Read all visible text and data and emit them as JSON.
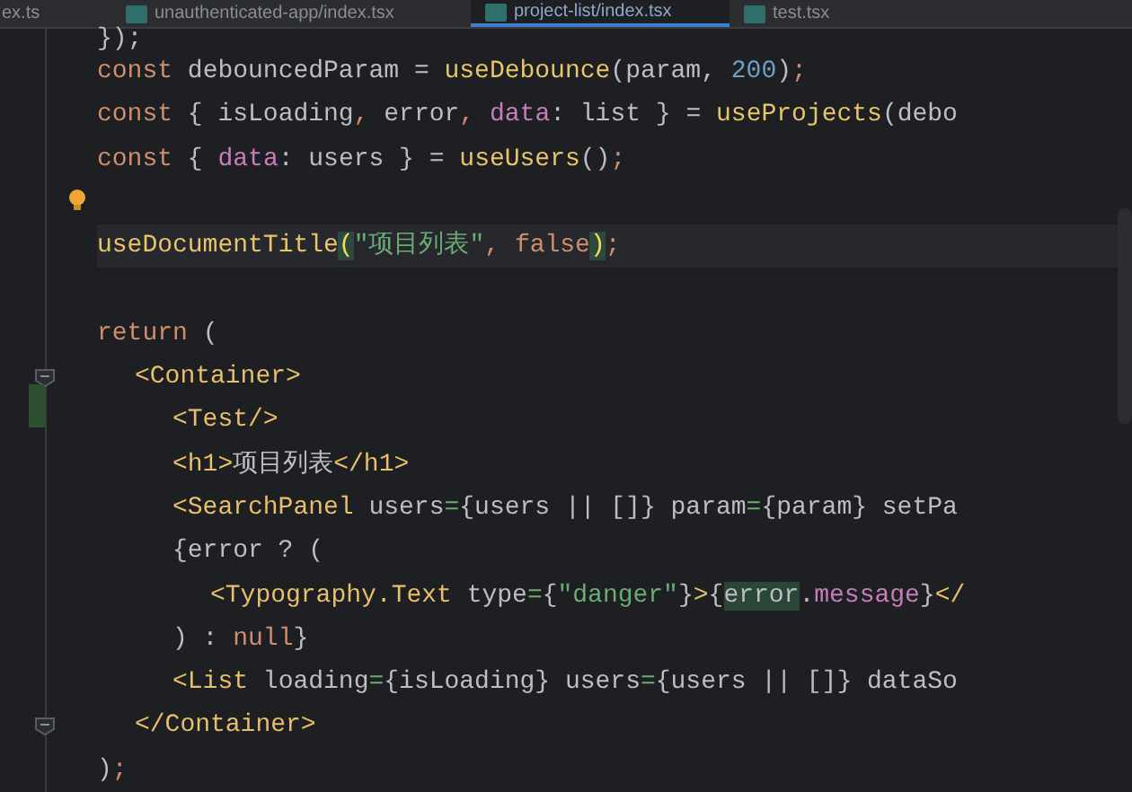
{
  "tabs": [
    {
      "label": "ex.ts",
      "selected": false,
      "icon": false
    },
    {
      "label": "unauthenticated-app/index.tsx",
      "selected": false,
      "icon": true
    },
    {
      "label": "project-list/index.tsx",
      "selected": true,
      "icon": true
    },
    {
      "label": "test.tsx",
      "selected": false,
      "icon": true
    }
  ],
  "lines": [
    {
      "current": false,
      "tokens": [
        {
          "kind": "plain",
          "text": "});"
        }
      ]
    },
    {
      "current": false,
      "tokens": [
        {
          "kind": "kw",
          "text": "const "
        },
        {
          "kind": "plain",
          "text": "debouncedParam = "
        },
        {
          "kind": "fn",
          "text": "useDebounce"
        },
        {
          "kind": "plain",
          "text": "(param, "
        },
        {
          "kind": "num",
          "text": "200"
        },
        {
          "kind": "plain",
          "text": ")"
        },
        {
          "kind": "kw",
          "text": ";"
        }
      ]
    },
    {
      "current": false,
      "tokens": [
        {
          "kind": "kw",
          "text": "const "
        },
        {
          "kind": "plain",
          "text": "{ isLoading"
        },
        {
          "kind": "kw",
          "text": ", "
        },
        {
          "kind": "plain",
          "text": "error"
        },
        {
          "kind": "kw",
          "text": ", "
        },
        {
          "kind": "prop",
          "text": "data"
        },
        {
          "kind": "plain",
          "text": ": list } = "
        },
        {
          "kind": "fn",
          "text": "useProjects"
        },
        {
          "kind": "plain",
          "text": "(debo"
        }
      ]
    },
    {
      "current": false,
      "tokens": [
        {
          "kind": "kw",
          "text": "const "
        },
        {
          "kind": "plain",
          "text": "{ "
        },
        {
          "kind": "prop",
          "text": "data"
        },
        {
          "kind": "plain",
          "text": ": users } = "
        },
        {
          "kind": "fn",
          "text": "useUsers"
        },
        {
          "kind": "plain",
          "text": "()"
        },
        {
          "kind": "kw",
          "text": ";"
        }
      ]
    },
    {
      "current": false,
      "bulb": true
    },
    {
      "current": true,
      "tokens": [
        {
          "kind": "fn",
          "text": "useDocumentTitle"
        },
        {
          "kind": "match",
          "text": "("
        },
        {
          "kind": "str",
          "text": "\"项目列表\""
        },
        {
          "kind": "kw",
          "text": ", false"
        },
        {
          "kind": "match",
          "text": ")"
        },
        {
          "kind": "kw",
          "text": ";"
        }
      ]
    },
    {
      "current": false
    },
    {
      "current": false,
      "tokens": [
        {
          "kind": "kw",
          "text": "return "
        },
        {
          "kind": "plain",
          "text": "("
        }
      ],
      "children": [
        {
          "current": false,
          "fold": true,
          "tokens": [
            {
              "kind": "tag",
              "text": "<Container>"
            }
          ],
          "children": [
            {
              "current": false,
              "changed": true,
              "tokens": [
                {
                  "kind": "tag",
                  "text": "<Test/>"
                }
              ]
            },
            {
              "current": false,
              "tokens": [
                {
                  "kind": "tag",
                  "text": "<h1>"
                },
                {
                  "kind": "plain",
                  "text": "项目列表"
                },
                {
                  "kind": "tag",
                  "text": "</h1>"
                }
              ]
            },
            {
              "current": false,
              "tokens": [
                {
                  "kind": "tag",
                  "text": "<SearchPanel "
                },
                {
                  "kind": "plain",
                  "text": "users"
                },
                {
                  "kind": "op",
                  "text": "="
                },
                {
                  "kind": "plain",
                  "text": "{users || []} param"
                },
                {
                  "kind": "op",
                  "text": "="
                },
                {
                  "kind": "plain",
                  "text": "{param} setPa"
                }
              ]
            },
            {
              "current": false,
              "tokens": [
                {
                  "kind": "plain",
                  "text": "{error ? ("
                }
              ],
              "children": [
                {
                  "current": false,
                  "tokens": [
                    {
                      "kind": "tag",
                      "text": "<Typography.Text "
                    },
                    {
                      "kind": "plain",
                      "text": "type"
                    },
                    {
                      "kind": "op",
                      "text": "="
                    },
                    {
                      "kind": "plain",
                      "text": "{"
                    },
                    {
                      "kind": "str",
                      "text": "\"danger\""
                    },
                    {
                      "kind": "plain",
                      "text": "}"
                    },
                    {
                      "kind": "tag",
                      "text": ">"
                    },
                    {
                      "kind": "plain",
                      "text": "{"
                    },
                    {
                      "kind": "usage",
                      "text": "error"
                    },
                    {
                      "kind": "plain",
                      "text": "."
                    },
                    {
                      "kind": "prop",
                      "text": "message"
                    },
                    {
                      "kind": "plain",
                      "text": "}"
                    },
                    {
                      "kind": "tag",
                      "text": "</"
                    }
                  ]
                }
              ]
            },
            {
              "current": false,
              "tokens": [
                {
                  "kind": "plain",
                  "text": ") : "
                },
                {
                  "kind": "kw",
                  "text": "null"
                },
                {
                  "kind": "plain",
                  "text": "}"
                }
              ]
            },
            {
              "current": false,
              "tokens": [
                {
                  "kind": "tag",
                  "text": "<List "
                },
                {
                  "kind": "plain",
                  "text": "loading"
                },
                {
                  "kind": "op",
                  "text": "="
                },
                {
                  "kind": "plain",
                  "text": "{isLoading} users"
                },
                {
                  "kind": "op",
                  "text": "="
                },
                {
                  "kind": "plain",
                  "text": "{users || []} dataSo"
                }
              ]
            }
          ]
        },
        {
          "current": false,
          "fold": true,
          "tokens": [
            {
              "kind": "tag",
              "text": "</Container>"
            }
          ]
        }
      ]
    },
    {
      "current": false,
      "tokens": [
        {
          "kind": "plain",
          "text": ")"
        },
        {
          "kind": "kw",
          "text": ";"
        }
      ]
    }
  ]
}
